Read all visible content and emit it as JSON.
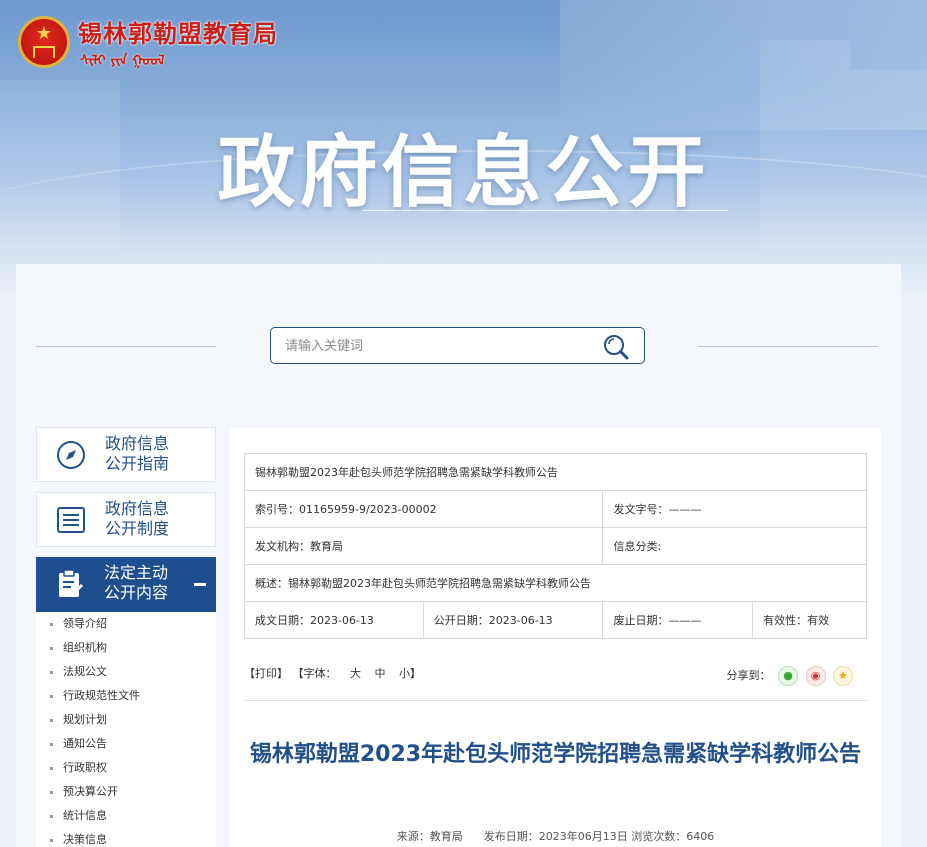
{
  "header": {
    "site_title": "锡林郭勒盟教育局",
    "site_mongolian": "ᠰᠢᠯᠢ ᠶᠢᠨ ᠭᠣᠣᠯ",
    "banner_title": "政府信息公开"
  },
  "search": {
    "placeholder": "请输入关键词"
  },
  "sidebar": {
    "cards": [
      {
        "label_line1": "政府信息",
        "label_line2": "公开指南",
        "icon": "compass-icon"
      },
      {
        "label_line1": "政府信息",
        "label_line2": "公开制度",
        "icon": "document-list-icon"
      }
    ],
    "active": {
      "label_line1": "法定主动",
      "label_line2": "公开内容",
      "icon": "clipboard-edit-icon"
    },
    "items": [
      {
        "label": "领导介绍"
      },
      {
        "label": "组织机构"
      },
      {
        "label": "法规公文"
      },
      {
        "label": "行政规范性文件"
      },
      {
        "label": "规划计划"
      },
      {
        "label": "通知公告"
      },
      {
        "label": "行政职权"
      },
      {
        "label": "预决算公开"
      },
      {
        "label": "统计信息"
      },
      {
        "label": "决策信息"
      }
    ]
  },
  "meta": {
    "title": "锡林郭勒盟2023年赴包头师范学院招聘急需紧缺学科教师公告",
    "index_no": "索引号：01165959-9/2023-00002",
    "doc_no": "发文字号：———",
    "issuer": "发文机构：教育局",
    "category": "信息分类:",
    "summary": "概述：锡林郭勒盟2023年赴包头师范学院招聘急需紧缺学科教师公告",
    "created": "成文日期：2023-06-13",
    "published": "公开日期：2023-06-13",
    "expired": "废止日期：———",
    "validity": "有效性：有效"
  },
  "toolbar": {
    "print": "【打印】",
    "font_label": "【字体：",
    "font_large": "大",
    "font_medium": "中",
    "font_small": "小】",
    "share_label": "分享到："
  },
  "article": {
    "title": "锡林郭勒盟2023年赴包头师范学院招聘急需紧缺学科教师公告",
    "meta": "来源：教育局      发布日期：2023年06月13日 浏览次数：6406"
  },
  "colors": {
    "brand_blue": "#1d4f8e",
    "title_blue": "#23508a",
    "site_red": "#c8201a"
  }
}
